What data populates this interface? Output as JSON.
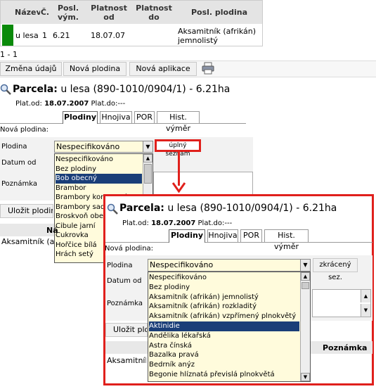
{
  "table": {
    "headers": [
      "Název",
      "Č.",
      "Posl. vým.",
      "Platnost od",
      "Platnost do",
      "Posl. plodina"
    ],
    "row": {
      "nazev": "u lesa",
      "cislo": "1",
      "posl_vym": "6.21",
      "platnost_od": "18.07.07",
      "platnost_do": "",
      "posl_plodina": "Aksamitník (afrikán) jemnolistý"
    },
    "row_marker_color": "#0a8a0a"
  },
  "pager": "1 - 1",
  "toolbar": {
    "change_label": "Změna údajů",
    "new_crop_label": "Nová plodina",
    "new_app_label": "Nová aplikace",
    "print_icon": "printer-icon"
  },
  "parcel": {
    "label": "Parcela:",
    "title": "u lesa (890-1010/0904/1) - 6.21ha",
    "plat_od_label": "Plat.od:",
    "plat_od_value": "18.07.2007",
    "plat_do_label": "Plat.do:",
    "plat_do_value": "---"
  },
  "tabs": [
    "Plodiny",
    "Hnojiva",
    "POR",
    "Hist. výměr"
  ],
  "form": {
    "section_title": "Nová plodina:",
    "crop_label": "Plodina",
    "date_label": "Datum od",
    "note_label": "Poznámka",
    "crop_value": "Nespecifikováno",
    "save_label": "Uložit plodinu",
    "full_list_label": "úplný seznam",
    "short_list_label": "zkrácený sez."
  },
  "left_dropdown": [
    "Nespecifikováno",
    "Bez plodiny",
    "Bob obecný",
    "Brambor",
    "Brambory konzumní",
    "Brambory sadbové",
    "Broskvoň obecná",
    "Cibule jarní",
    "Cukrovka",
    "Hořčice bílá",
    "Hrách setý"
  ],
  "left_dropdown_selected": "Bob obecný",
  "right_dropdown": [
    "Nespecifikováno",
    "Bez plodiny",
    "Aksamitník (afrikán) jemnolistý",
    "Aksamitník (afrikán) rozkladitý",
    "Aksamitník (afrikán) vzpřímený plnokvětý",
    "Aktinidie",
    "Andělika lékařská",
    "Astra čínská",
    "Bazalka pravá",
    "Bedrník anýz",
    "Begonie hlíznatá převislá plnokvětá"
  ],
  "right_dropdown_selected": "Aktinidie",
  "bottom_left": {
    "col_label": "Ná",
    "row_text": "Aksamitník (afr"
  },
  "bottom_right": {
    "col_s": "s",
    "col_note": "Poznámka",
    "row_text": "Aksamitník (afr"
  },
  "colors": {
    "highlight_red": "#e0201c",
    "dropdown_bg": "#fffbdc",
    "selected_bg": "#1a3e78"
  }
}
